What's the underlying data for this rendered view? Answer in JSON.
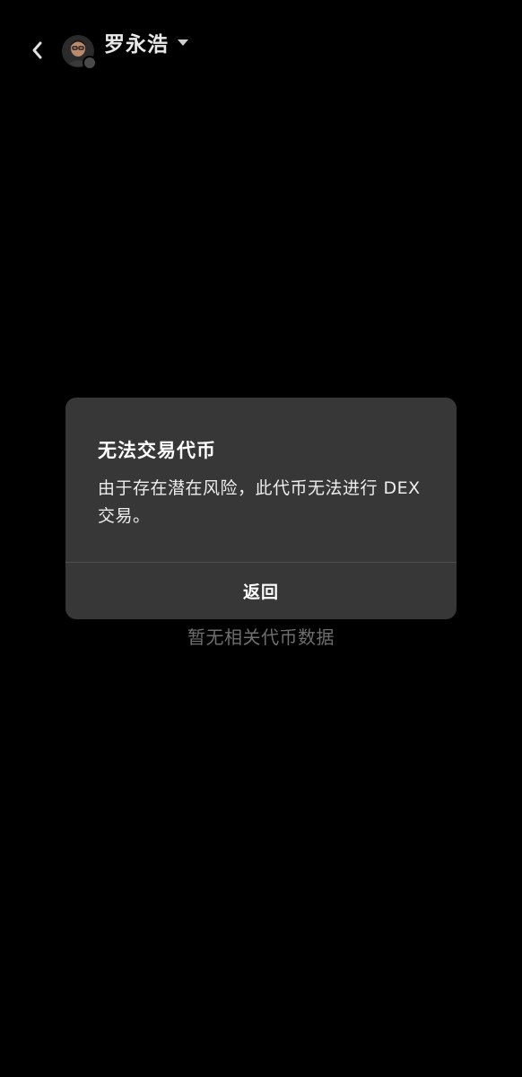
{
  "header": {
    "back_icon": "chevron-left-icon",
    "account_name": "罗永浩",
    "dropdown_icon": "caret-down-icon",
    "avatar_icon": "user-avatar"
  },
  "content": {
    "empty_text": "暂无相关代币数据"
  },
  "dialog": {
    "title": "无法交易代币",
    "message": "由于存在潜在风险，此代币无法进行 DEX 交易。",
    "button_label": "返回"
  },
  "colors": {
    "background": "#000000",
    "dialog_background": "#373737",
    "empty_text": "#6e6e6e"
  }
}
